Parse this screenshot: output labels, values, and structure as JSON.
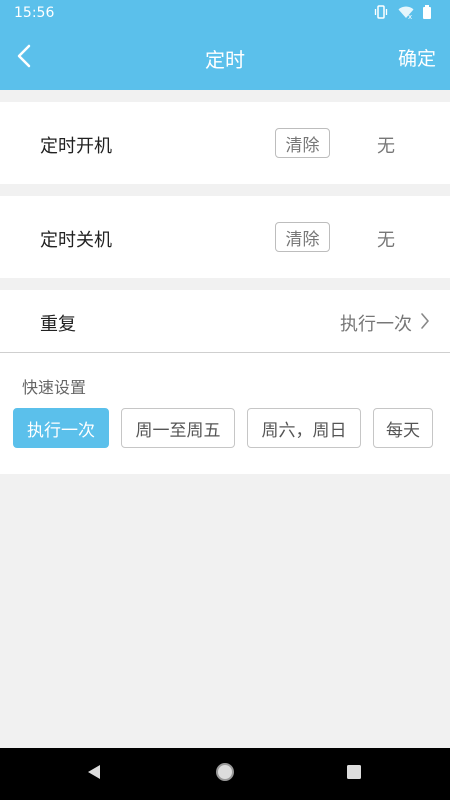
{
  "status_bar": {
    "time": "15:56",
    "icons": [
      "vibrate-icon",
      "wifi-icon",
      "battery-icon"
    ]
  },
  "header": {
    "title": "定时",
    "confirm_label": "确定",
    "back_icon": "chevron-left-icon",
    "background_color": "#5bc0eb"
  },
  "timer_on": {
    "label": "定时开机",
    "clear_label": "清除",
    "value": "无"
  },
  "timer_off": {
    "label": "定时关机",
    "clear_label": "清除",
    "value": "无"
  },
  "repeat": {
    "label": "重复",
    "value": "执行一次",
    "chevron_icon": "chevron-right-icon"
  },
  "quick_settings": {
    "label": "快速设置",
    "options": [
      "执行一次",
      "周一至周五",
      "周六，周日",
      "每天"
    ],
    "selected": "执行一次",
    "active_color": "#5bc0eb"
  },
  "nav_bar": {
    "icons": [
      "back-triangle-icon",
      "home-circle-icon",
      "recents-square-icon"
    ]
  }
}
